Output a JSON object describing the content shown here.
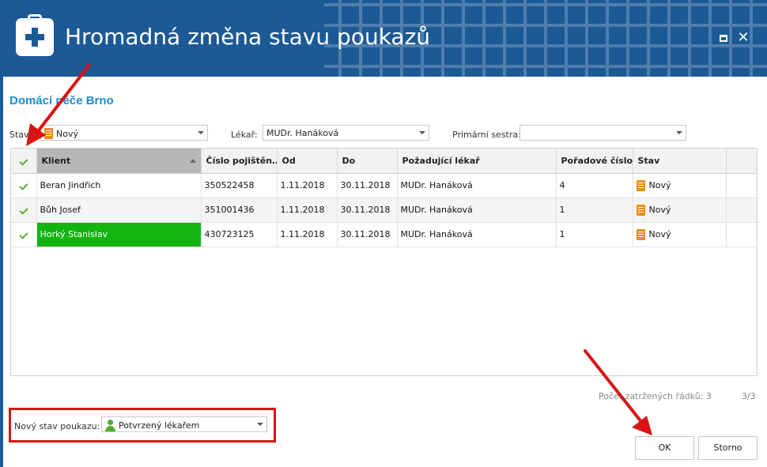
{
  "window": {
    "title": "Hromadná změna stavu poukazů",
    "maximize_icon": "maximize-icon",
    "close_glyph": "✕"
  },
  "org_name": "Domácí péče Brno",
  "filters": {
    "stav_label": "Stav:",
    "stav_value": "Nový",
    "lekar_label": "Lékař:",
    "lekar_value": "MUDr. Hanáková",
    "sestra_label": "Primární sestra:",
    "sestra_value": ""
  },
  "table": {
    "columns": [
      "Klient",
      "Číslo pojištěn…",
      "Od",
      "Do",
      "Požadující lékař",
      "Pořadové číslo",
      "Stav"
    ],
    "sorted_column": "Klient",
    "rows": [
      {
        "klient": "Beran Jindřich",
        "cislo": "350522458",
        "od": "1.11.2018",
        "do": "30.11.2018",
        "lekar": "MUDr. Hanáková",
        "poradove": "4",
        "stav": "Nový",
        "checked": true,
        "selected": false
      },
      {
        "klient": "Bůh Josef",
        "cislo": "351001436",
        "od": "1.11.2018",
        "do": "30.11.2018",
        "lekar": "MUDr. Hanáková",
        "poradove": "1",
        "stav": "Nový",
        "checked": true,
        "selected": false
      },
      {
        "klient": "Horký Stanislav",
        "cislo": "430723125",
        "od": "1.11.2018",
        "do": "30.11.2018",
        "lekar": "MUDr. Hanáková",
        "poradove": "1",
        "stav": "Nový",
        "checked": true,
        "selected": true
      }
    ]
  },
  "footer": {
    "count_label": "Počet zatržených řádků: 3",
    "page_label": "3/3",
    "new_state_label": "Nový stav poukazu:",
    "new_state_value": "Potvrzený lékařem",
    "ok_label": "OK",
    "cancel_label": "Storno"
  },
  "colors": {
    "titlebar": "#1c5a95",
    "org_title": "#1f8dd0",
    "selected_cell": "#11b411",
    "check": "#5cb030",
    "doc_icon": "#f08a1c",
    "annotation_red": "#d81414"
  }
}
